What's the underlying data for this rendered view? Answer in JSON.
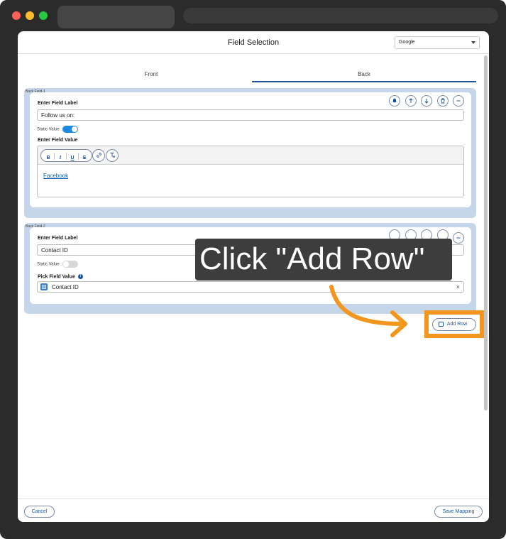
{
  "modal": {
    "title": "Field Selection",
    "dropdown_value": "Google"
  },
  "tabs": [
    {
      "label": "Front"
    },
    {
      "label": "Back"
    }
  ],
  "field1": {
    "tag": "Back Field-1",
    "label_heading": "Enter Field Label",
    "label_value": "Follow us on:",
    "static_value_label": "Static Value",
    "value_heading": "Enter Field Value",
    "editor_toolbar": [
      "B",
      "I",
      "U",
      "S"
    ],
    "link_text": "Facebook"
  },
  "field2": {
    "tag": "Back Field-2",
    "label_heading": "Enter Field Label",
    "label_value": "Contact ID",
    "static_value_label": "Static Value",
    "pick_heading": "Pick Field Value",
    "pick_value": "Contact ID"
  },
  "overlay": {
    "text": "Click \"Add Row\""
  },
  "actions": {
    "add_row": "Add Row",
    "cancel": "Cancel",
    "save": "Save Mapping"
  },
  "colors": {
    "accent": "#1b5297",
    "card_bg": "#c5d6ea",
    "highlight": "#f3961e",
    "toggle_on": "#1b8be0"
  }
}
